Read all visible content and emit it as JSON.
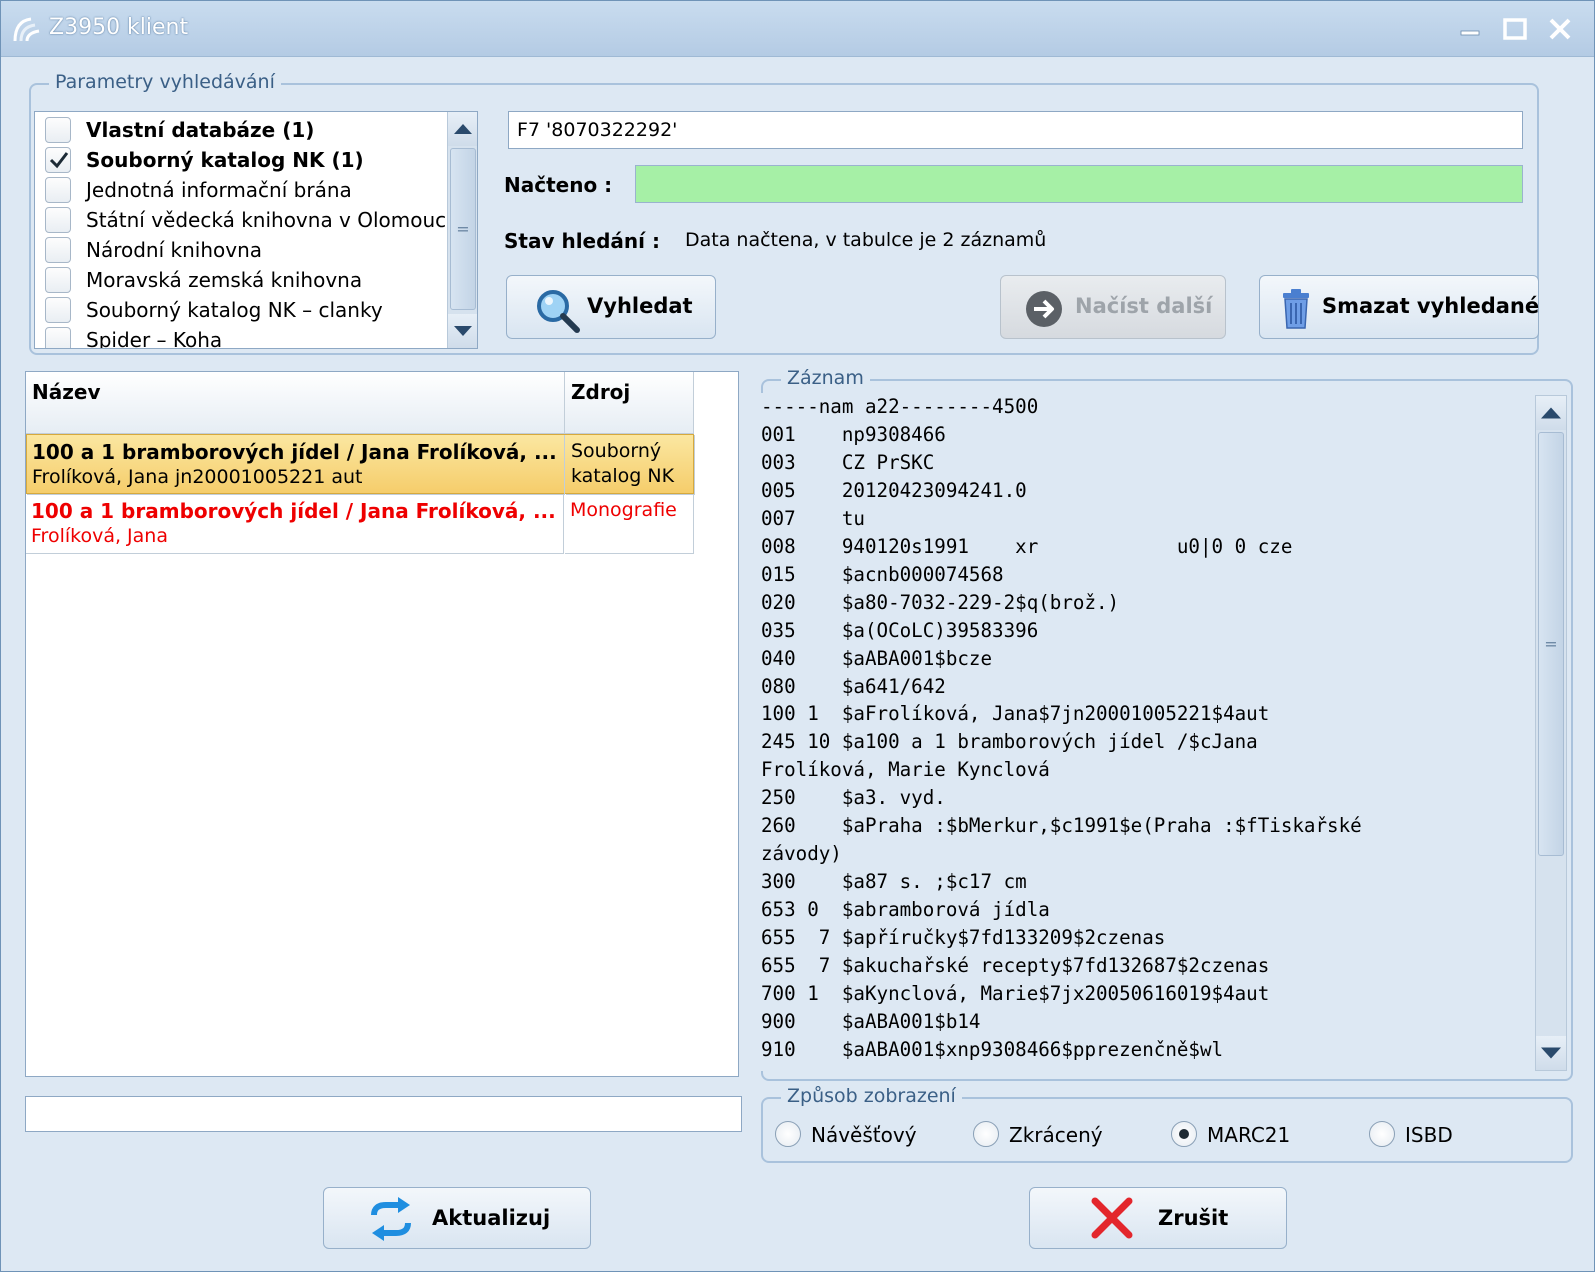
{
  "window": {
    "title": "Z3950 klient",
    "icons": [
      "app-icon",
      "minimize-icon",
      "maximize-icon",
      "close-icon"
    ]
  },
  "search_params": {
    "legend": "Parametry vyhledávání",
    "databases": [
      {
        "label": "Vlastní databáze (1)",
        "checked": false,
        "bold": true
      },
      {
        "label": "Souborný katalog NK (1)",
        "checked": true,
        "bold": true
      },
      {
        "label": "Jednotná informační brána",
        "checked": false,
        "bold": false
      },
      {
        "label": "Státní vědecká knihovna v Olomouci",
        "checked": false,
        "bold": false
      },
      {
        "label": "Národní knihovna",
        "checked": false,
        "bold": false
      },
      {
        "label": "Moravská zemská knihovna",
        "checked": false,
        "bold": false
      },
      {
        "label": "Souborný katalog NK – clanky",
        "checked": false,
        "bold": false
      },
      {
        "label": "Spider – Koha",
        "checked": false,
        "bold": false
      }
    ],
    "query_value": "F7 '8070322292'",
    "loaded_label": "Načteno :",
    "loaded_progress": 1.0,
    "status_label": "Stav hledání :",
    "status_text": "Data načtena, v tabulce je 2 záznamů",
    "search_button": "Vyhledat",
    "load_more_button": "Načíst další",
    "clear_button": "Smazat vyhledané"
  },
  "results": {
    "columns": [
      "Název",
      "Zdroj"
    ],
    "rows": [
      {
        "title": "100 a 1 bramborových jídel / Jana Frolíková, ...",
        "author": "Frolíková, Jana jn20001005221 aut",
        "source": "Souborný katalog NK",
        "selected": true
      },
      {
        "title": "100 a 1 bramborových jídel / Jana Frolíková, ...",
        "author": "Frolíková, Jana",
        "source": "Monografie",
        "selected": false
      }
    ],
    "filter_value": ""
  },
  "record": {
    "legend": "Záznam",
    "lines": [
      "-----nam a22--------4500",
      "001    np9308466",
      "003    CZ PrSKC",
      "005    20120423094241.0",
      "007    tu",
      "008    940120s1991    xr            u0|0 0 cze",
      "015    $acnb000074568",
      "020    $a80-7032-229-2$q(brož.)",
      "035    $a(OCoLC)39583396",
      "040    $aABA001$bcze",
      "080    $a641/642",
      "100 1  $aFrolíková, Jana$7jn20001005221$4aut",
      "245 10 $a100 a 1 bramborových jídel /$cJana",
      "Frolíková, Marie Kynclová",
      "250    $a3. vyd.",
      "260    $aPraha :$bMerkur,$c1991$e(Praha :$fTiskařské",
      "závody)",
      "300    $a87 s. ;$c17 cm",
      "653 0  $abramborová jídla",
      "655  7 $apříručky$7fd133209$2czenas",
      "655  7 $akuchařské recepty$7fd132687$2czenas",
      "700 1  $aKynclová, Marie$7jx20050616019$4aut",
      "900    $aABA001$b14",
      "910    $aABA001$xnp9308466$pprezenčně$wl"
    ]
  },
  "display_mode": {
    "legend": "Způsob zobrazení",
    "options": [
      {
        "label": "Návěšťový",
        "selected": false
      },
      {
        "label": "Zkrácený",
        "selected": false
      },
      {
        "label": "MARC21",
        "selected": true
      },
      {
        "label": "ISBD",
        "selected": false
      }
    ]
  },
  "footer": {
    "refresh_button": "Aktualizuj",
    "cancel_button": "Zrušit"
  },
  "colors": {
    "progress_fill": "#a6f0a6",
    "selected_row": "#f5cd6b",
    "red_text": "#ee0000",
    "window_bg": "#dde8f3"
  }
}
